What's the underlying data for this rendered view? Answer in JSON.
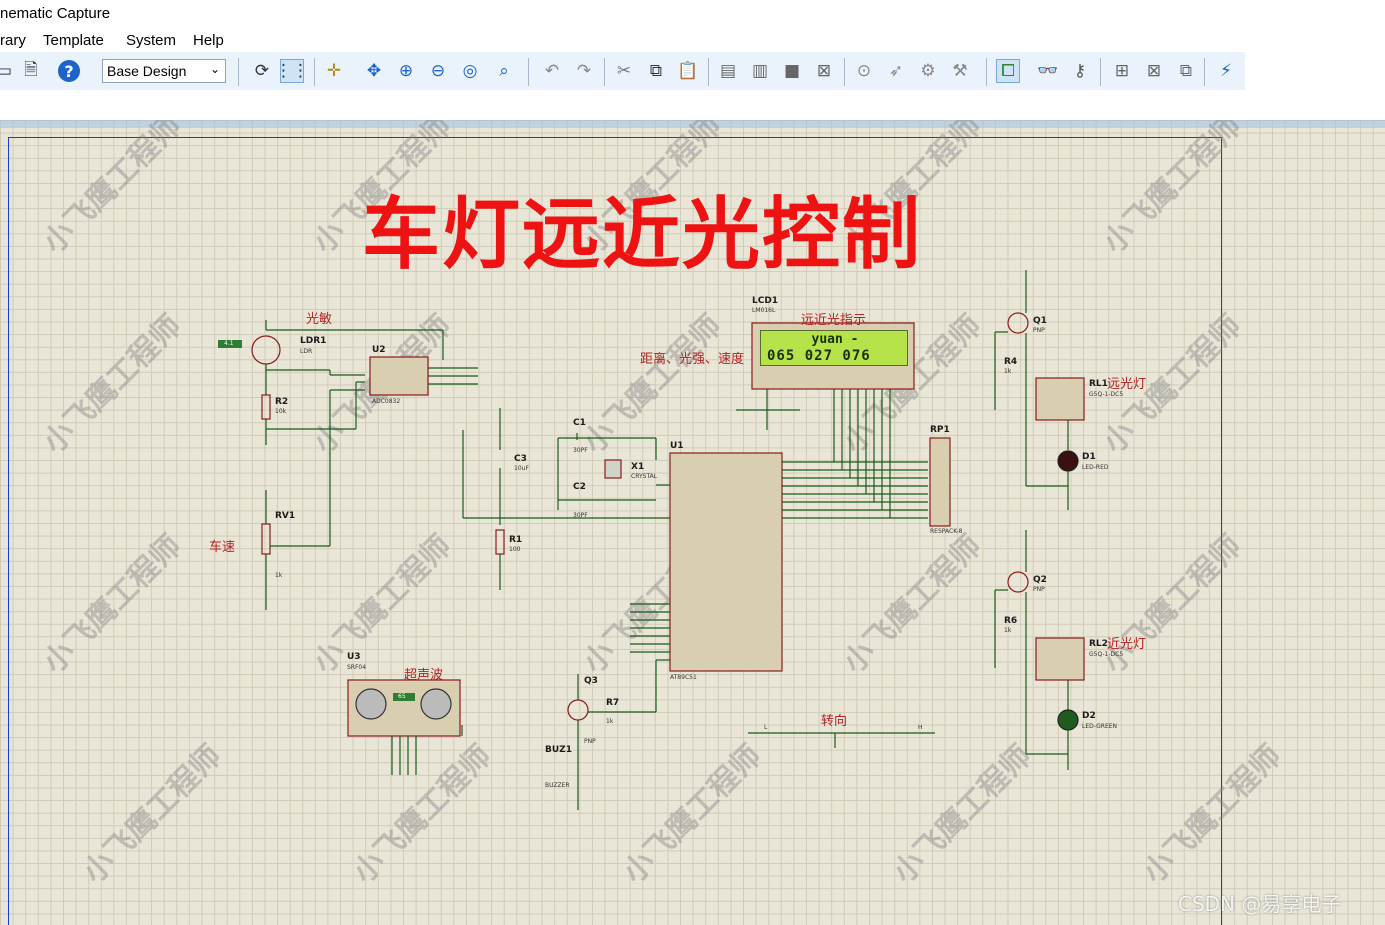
{
  "window": {
    "title": "nematic Capture"
  },
  "menu": {
    "items": [
      "rary",
      "Template",
      "System",
      "Help"
    ]
  },
  "toolbar": {
    "design_select_value": "Base Design"
  },
  "schematic": {
    "title": "车灯远近光控制",
    "watermark_text": "小飞鹰工程师",
    "labels": {
      "ldr_section": "光敏",
      "speed_section": "车速",
      "ultrasonic_section": "超声波",
      "lcd_indicator": "远近光指示",
      "lcd_fields": "距离、光强、速度",
      "turn_signal": "转向",
      "far_light": "远光灯",
      "near_light": "近光灯"
    },
    "lcd": {
      "ref": "LCD1",
      "model": "LM016L",
      "line1": "yuan  -",
      "line2": "065 027  076"
    },
    "components": {
      "ldr": {
        "ref": "LDR1",
        "model": "LDR",
        "display": "4.1"
      },
      "adc": {
        "ref": "U2",
        "model": "ADC0832"
      },
      "r2": {
        "ref": "R2",
        "value": "10k"
      },
      "rv1": {
        "ref": "RV1",
        "value": "1k"
      },
      "u3": {
        "ref": "U3",
        "model": "SRF04",
        "display": "65"
      },
      "c1": {
        "ref": "C1",
        "value": "30PF"
      },
      "c2": {
        "ref": "C2",
        "value": "30PF"
      },
      "c3": {
        "ref": "C3",
        "value": "10uF"
      },
      "x1": {
        "ref": "X1",
        "model": "CRYSTAL"
      },
      "r1": {
        "ref": "R1",
        "value": "100"
      },
      "u1": {
        "ref": "U1",
        "model": "AT89C51"
      },
      "rp1": {
        "ref": "RP1",
        "model": "RESPACK-8"
      },
      "q1": {
        "ref": "Q1",
        "model": "PNP"
      },
      "q2": {
        "ref": "Q2",
        "model": "PNP"
      },
      "q3": {
        "ref": "Q3",
        "model": "PNP"
      },
      "r4": {
        "ref": "R4",
        "value": "1k"
      },
      "r6": {
        "ref": "R6",
        "value": "1k"
      },
      "r7": {
        "ref": "R7",
        "value": "1k"
      },
      "rl1": {
        "ref": "RL1",
        "model": "G5Q-1-DC5"
      },
      "rl2": {
        "ref": "RL2",
        "model": "G5Q-1-DC5"
      },
      "d1": {
        "ref": "D1",
        "model": "LED-RED"
      },
      "d2": {
        "ref": "D2",
        "model": "LED-GREEN"
      },
      "buz1": {
        "ref": "BUZ1",
        "model": "BUZZER"
      }
    },
    "turn_switch": {
      "left": "L",
      "right": "H"
    }
  },
  "footer": {
    "credit": "CSDN @易享电子"
  }
}
